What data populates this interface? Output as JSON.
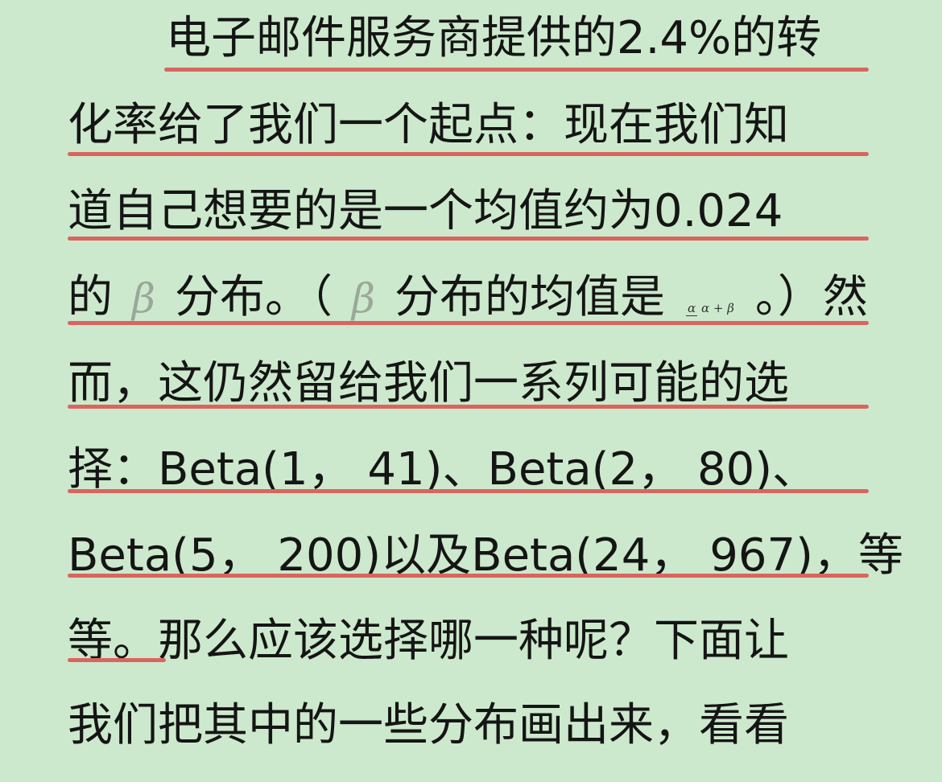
{
  "document": {
    "lines": [
      "电子邮件服务商提供的2.4%的转",
      "化率给了我们一个起点：现在我们知",
      "道自己想要的是一个均值约为0.024",
      {
        "seg1": "的",
        "beta1": "β",
        "seg2": "分布。（",
        "beta2": "β",
        "seg3": "分布的均值是",
        "frac_num": "α",
        "frac_den": "α + β",
        "seg4": "。）然"
      },
      "而，这仍然留给我们一系列可能的选",
      "择：Beta(1， 41)、Beta(2， 80)、",
      "Beta(5， 200)以及Beta(24， 967)，等",
      "等。那么应该选择哪一种呢？下面让",
      "我们把其中的一些分布画出来，看看"
    ]
  },
  "colors": {
    "background": "#cde9cd",
    "text": "#151515",
    "underline": "#d9655f"
  }
}
